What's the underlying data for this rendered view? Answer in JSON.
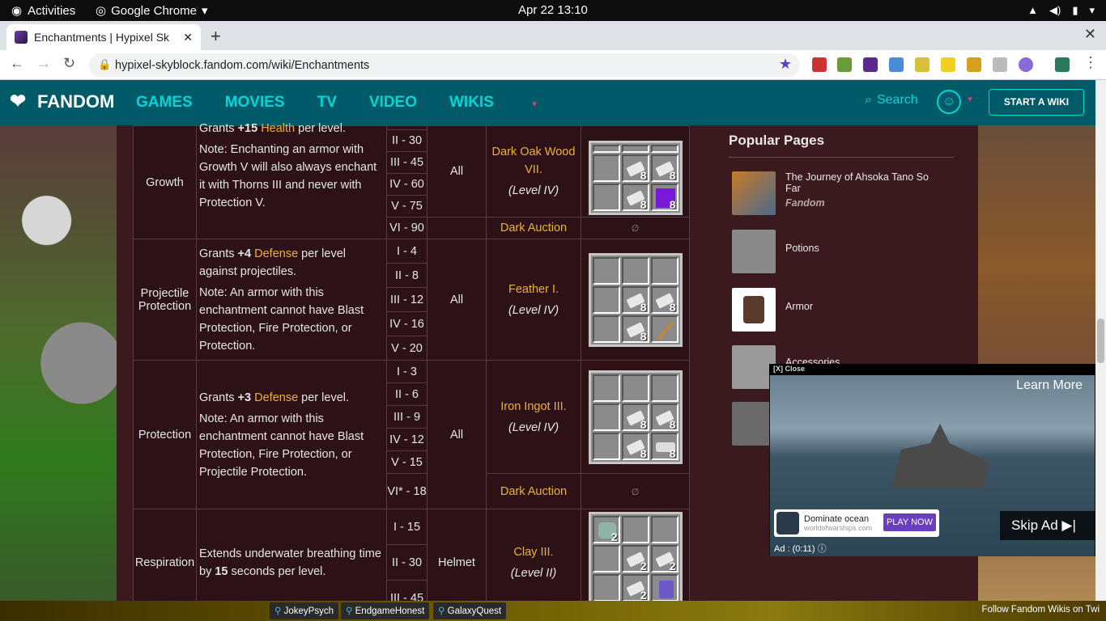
{
  "system": {
    "activities": "Activities",
    "app": "Google Chrome",
    "clock": "Apr 22  13:10"
  },
  "browser": {
    "tab_title": "Enchantments | Hypixel Sk",
    "url": "hypixel-skyblock.fandom.com/wiki/Enchantments"
  },
  "fandom": {
    "logo": "FANDOM",
    "nav": [
      "GAMES",
      "MOVIES",
      "TV",
      "VIDEO",
      "WIKIS"
    ],
    "search": "Search",
    "start_wiki": "START A WIKI"
  },
  "table": {
    "rows": [
      {
        "name": "Growth",
        "desc_top": "Grants +15 Health per level.",
        "desc_note": "Note: Enchanting an armor with Growth V will also always enchant it with Thorns III and never with Protection V.",
        "levels": [
          "II - 30",
          "III - 45",
          "IV - 60",
          "V - 75",
          "VI - 90"
        ],
        "applies": "All",
        "source": "Dark Oak Wood VII.",
        "source_level": "(Level IV)",
        "source2": "Dark Auction"
      },
      {
        "name": "Projectile Protection",
        "desc_top": "Grants +4 Defense per level against projectiles.",
        "desc_note": "Note: An armor with this enchantment cannot have Blast Protection, Fire Protection, or Protection.",
        "levels": [
          "I - 4",
          "II - 8",
          "III - 12",
          "IV - 16",
          "V - 20"
        ],
        "applies": "All",
        "source": "Feather I.",
        "source_level": "(Level IV)"
      },
      {
        "name": "Protection",
        "desc_top": "Grants +3 Defense per level.",
        "desc_note": "Note: An armor with this enchantment cannot have Blast Protection, Fire Protection, or Projectile Protection.",
        "levels": [
          "I - 3",
          "II - 6",
          "III - 9",
          "IV - 12",
          "V - 15",
          "VI* - 18"
        ],
        "applies": "All",
        "source": "Iron Ingot III.",
        "source_level": "(Level IV)",
        "source2": "Dark Auction"
      },
      {
        "name": "Respiration",
        "desc_top": "Extends underwater breathing time by 15 seconds per level.",
        "levels": [
          "I - 15",
          "II - 30",
          "III - 45"
        ],
        "applies": "Helmet",
        "source": "Clay III.",
        "source_level": "(Level II)"
      }
    ],
    "stack_8": "8",
    "stack_2": "2",
    "empty": "∅"
  },
  "popular": {
    "title": "Popular Pages",
    "items": [
      {
        "title": "The Journey of Ahsoka Tano So Far",
        "sub": "Fandom"
      },
      {
        "title": "Potions"
      },
      {
        "title": "Armor"
      },
      {
        "title": "Accessories"
      }
    ]
  },
  "ad": {
    "close": "[X] Close",
    "learn_more": "Learn More",
    "headline": "Dominate ocean",
    "domain": "worldofwarships.com",
    "play": "PLAY NOW",
    "skip": "Skip Ad ▶|",
    "timer": "Ad : (0:11)"
  },
  "taskbar": {
    "items": [
      "JokeyPsych",
      "EndgameHonest",
      "GalaxyQuest"
    ],
    "follow": "Follow Fandom Wikis on Twi"
  }
}
